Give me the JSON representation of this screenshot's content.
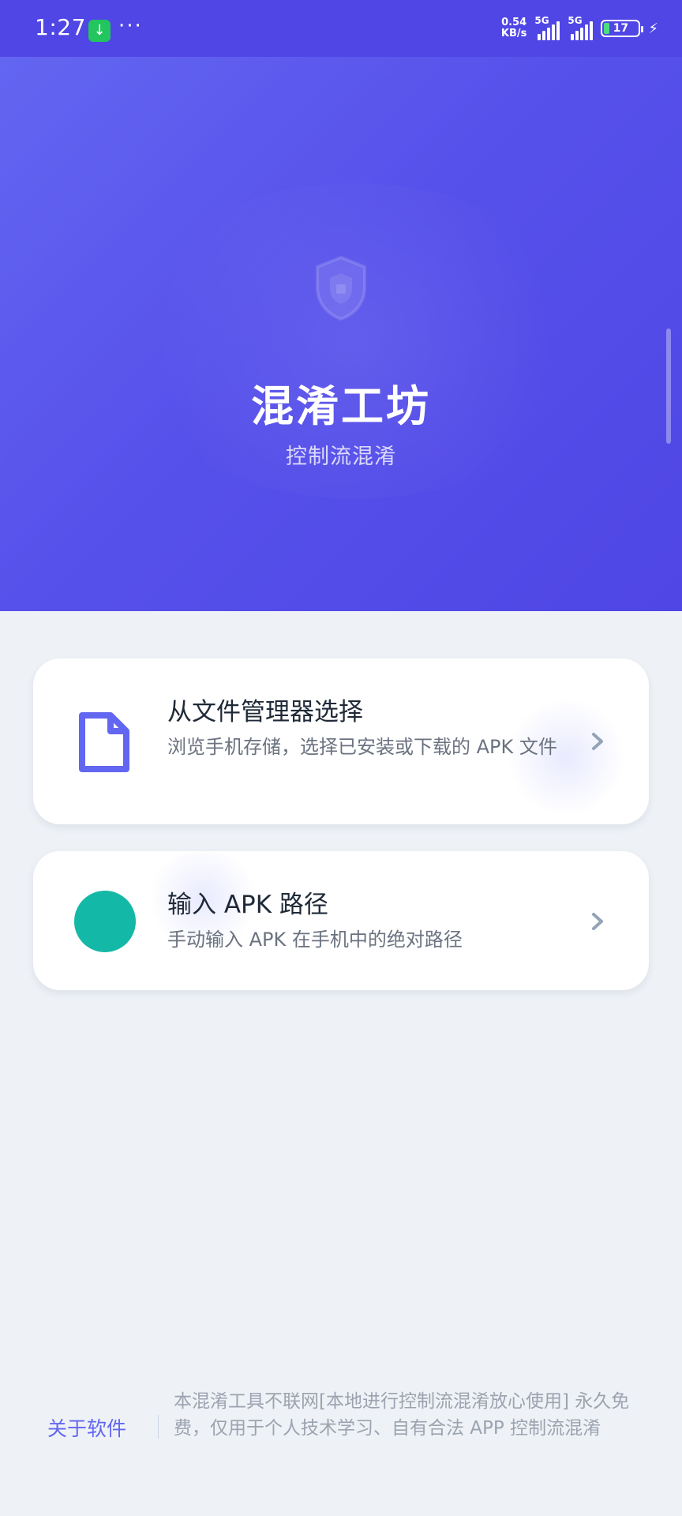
{
  "status_bar": {
    "time": "1:27",
    "download_icon": "download-arrow-icon",
    "more": "···",
    "net_speed_value": "0.54",
    "net_speed_unit": "KB/s",
    "signal1_label": "5G",
    "signal2_label": "5G",
    "battery_level": "17",
    "battery_fraction": 0.17,
    "charging_icon": "lightning-icon"
  },
  "hero": {
    "icon": "shield-icon",
    "title": "混淆工坊",
    "subtitle": "控制流混淆"
  },
  "options": [
    {
      "icon": "document-icon",
      "title": "从文件管理器选择",
      "description": "浏览手机存储，选择已安装或下载的 APK 文件",
      "chevron": "chevron-right-icon"
    },
    {
      "icon": "circle-icon",
      "title": "输入 APK 路径",
      "description": "手动输入 APK 在手机中的绝对路径",
      "chevron": "chevron-right-icon"
    }
  ],
  "footer": {
    "about_label": "关于软件",
    "disclaimer": "本混淆工具不联网[本地进行控制流混淆放心使用] 永久免费，仅用于个人技术学习、自有合法 APP 控制流混淆"
  },
  "colors": {
    "primary": "#4f46e5",
    "hero_gradient_start": "#6366f1",
    "accent_teal": "#14b8a6",
    "background": "#eef2f7",
    "card": "#ffffff"
  }
}
